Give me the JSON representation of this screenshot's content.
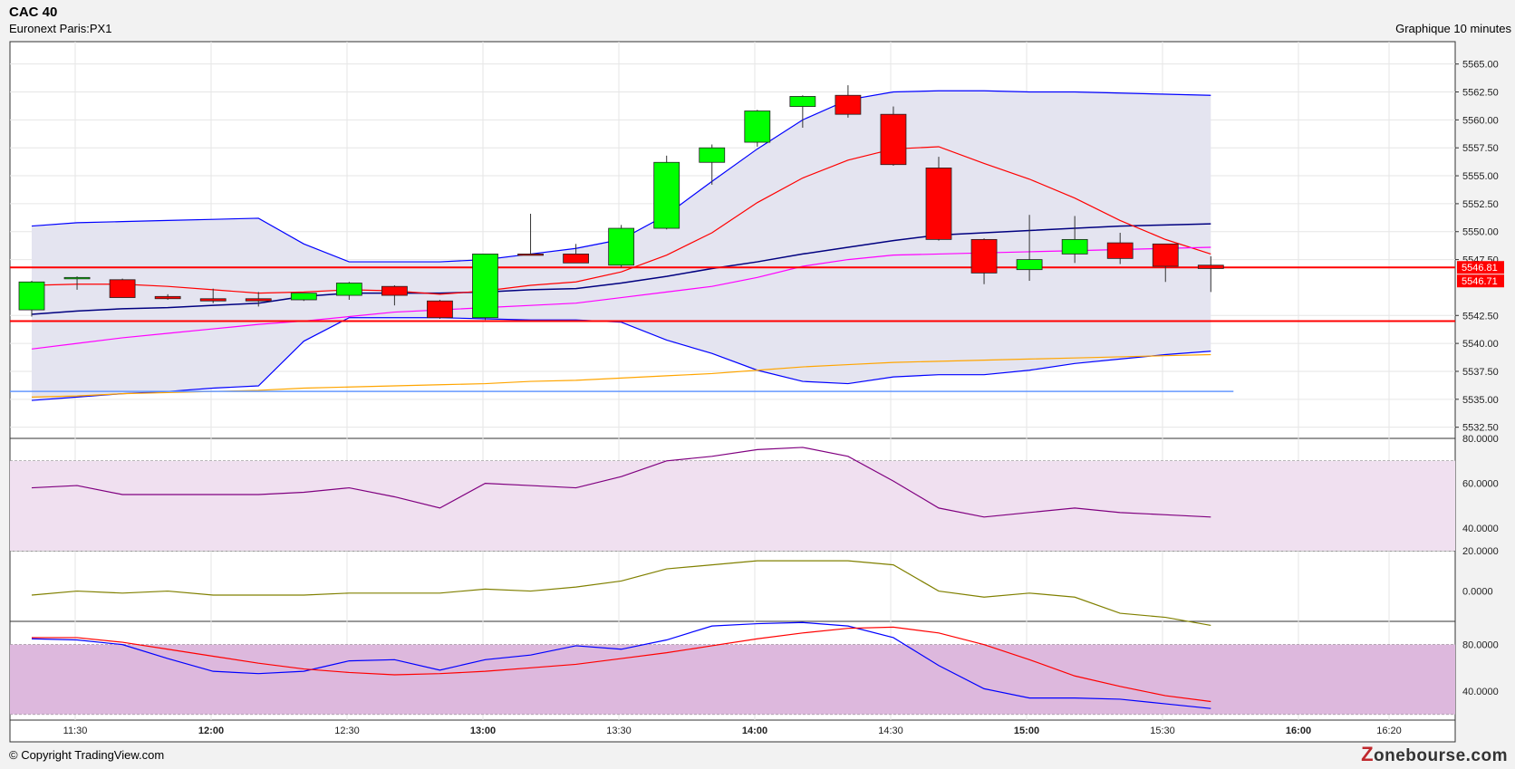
{
  "header": {
    "title": "CAC 40",
    "subtitle": "Euronext Paris:PX1",
    "interval_label": "Graphique 10 minutes"
  },
  "footer": {
    "copyright": "© Copyright TradingView.com",
    "logo_text": "zonebourse.com"
  },
  "colors": {
    "up_candle": "#00ff00",
    "down_candle": "#ff0000",
    "band_fill": "#e4e4f0",
    "band_line": "#0000ff",
    "ma_red": "#ff0000",
    "ma_magenta": "#ff00ff",
    "ma_orange": "#ffa500",
    "ma_light_blue": "#6699ff",
    "hline": "#ff0000",
    "rsi_line": "#800080",
    "rsi_zone": "#f0e0f0",
    "osc_line": "#808000",
    "stoch_fast": "#0000ff",
    "stoch_slow": "#ff0000",
    "stoch_zone": "#ddb8dd"
  },
  "chart_data": {
    "type": "candlestick",
    "x_ticks": [
      "11:30",
      "12:00",
      "12:30",
      "13:00",
      "13:30",
      "14:00",
      "14:30",
      "15:00",
      "15:30",
      "16:00",
      "16:20"
    ],
    "y_ticks": [
      "5565.00",
      "5562.50",
      "5560.00",
      "5557.50",
      "5555.00",
      "5552.50",
      "5550.00",
      "5547.50",
      "5542.50",
      "5540.00",
      "5537.50",
      "5535.00",
      "5532.50"
    ],
    "ylim": [
      5531.5,
      5567
    ],
    "price_labels": [
      "5546.81",
      "5546.71"
    ],
    "horizontal_lines": [
      5546.8,
      5542.0
    ],
    "candles": [
      {
        "time": "11:20",
        "o": 5543.0,
        "h": 5545.6,
        "l": 5542.4,
        "c": 5545.5
      },
      {
        "time": "11:30",
        "o": 5545.8,
        "h": 5546.0,
        "l": 5544.8,
        "c": 5545.9
      },
      {
        "time": "11:40",
        "o": 5545.7,
        "h": 5545.8,
        "l": 5544.1,
        "c": 5544.1
      },
      {
        "time": "11:50",
        "o": 5544.2,
        "h": 5544.4,
        "l": 5543.9,
        "c": 5544.0
      },
      {
        "time": "12:00",
        "o": 5544.0,
        "h": 5544.9,
        "l": 5543.6,
        "c": 5543.8
      },
      {
        "time": "12:10",
        "o": 5544.0,
        "h": 5544.6,
        "l": 5543.3,
        "c": 5543.8
      },
      {
        "time": "12:20",
        "o": 5543.9,
        "h": 5544.5,
        "l": 5543.8,
        "c": 5544.5
      },
      {
        "time": "12:30",
        "o": 5544.3,
        "h": 5545.5,
        "l": 5543.9,
        "c": 5545.4
      },
      {
        "time": "12:40",
        "o": 5545.1,
        "h": 5545.2,
        "l": 5543.4,
        "c": 5544.3
      },
      {
        "time": "12:50",
        "o": 5543.8,
        "h": 5543.9,
        "l": 5542.2,
        "c": 5542.3
      },
      {
        "time": "13:00",
        "o": 5542.3,
        "h": 5548.0,
        "l": 5542.1,
        "c": 5548.0
      },
      {
        "time": "13:10",
        "o": 5548.0,
        "h": 5551.6,
        "l": 5547.9,
        "c": 5547.9
      },
      {
        "time": "13:20",
        "o": 5548.0,
        "h": 5548.9,
        "l": 5547.2,
        "c": 5547.2
      },
      {
        "time": "13:30",
        "o": 5547.0,
        "h": 5550.6,
        "l": 5546.8,
        "c": 5550.3
      },
      {
        "time": "13:40",
        "o": 5550.3,
        "h": 5556.8,
        "l": 5550.2,
        "c": 5556.2
      },
      {
        "time": "13:50",
        "o": 5556.2,
        "h": 5557.8,
        "l": 5554.2,
        "c": 5557.5
      },
      {
        "time": "14:00",
        "o": 5558.0,
        "h": 5560.9,
        "l": 5557.6,
        "c": 5560.8
      },
      {
        "time": "14:10",
        "o": 5561.2,
        "h": 5562.2,
        "l": 5559.3,
        "c": 5562.1
      },
      {
        "time": "14:20",
        "o": 5562.2,
        "h": 5563.1,
        "l": 5560.2,
        "c": 5560.5
      },
      {
        "time": "14:30",
        "o": 5560.5,
        "h": 5561.2,
        "l": 5555.9,
        "c": 5556.0
      },
      {
        "time": "14:40",
        "o": 5555.7,
        "h": 5556.7,
        "l": 5549.2,
        "c": 5549.3
      },
      {
        "time": "14:50",
        "o": 5549.3,
        "h": 5549.4,
        "l": 5545.3,
        "c": 5546.3
      },
      {
        "time": "15:00",
        "o": 5546.6,
        "h": 5551.5,
        "l": 5545.6,
        "c": 5547.5
      },
      {
        "time": "15:10",
        "o": 5548.0,
        "h": 5551.4,
        "l": 5547.2,
        "c": 5549.3
      },
      {
        "time": "15:20",
        "o": 5549.0,
        "h": 5549.9,
        "l": 5547.1,
        "c": 5547.6
      },
      {
        "time": "15:30",
        "o": 5548.9,
        "h": 5548.9,
        "l": 5545.5,
        "c": 5546.9
      },
      {
        "time": "15:40",
        "o": 5547.0,
        "h": 5547.8,
        "l": 5544.6,
        "c": 5546.7
      }
    ],
    "bollinger_upper": [
      5550.5,
      5550.8,
      5550.9,
      5551.0,
      5551.1,
      5551.2,
      5548.9,
      5547.3,
      5547.3,
      5547.3,
      5547.5,
      5548.0,
      5548.5,
      5549.3,
      5551.5,
      5554.5,
      5557.4,
      5560.0,
      5561.8,
      5562.5,
      5562.6,
      5562.6,
      5562.5,
      5562.5,
      5562.4,
      5562.3,
      5562.2
    ],
    "bollinger_lower": [
      5534.9,
      5535.2,
      5535.5,
      5535.7,
      5536.0,
      5536.2,
      5540.2,
      5542.3,
      5542.3,
      5542.3,
      5542.2,
      5542.1,
      5542.1,
      5541.9,
      5540.3,
      5539.1,
      5537.6,
      5536.6,
      5536.4,
      5537.0,
      5537.2,
      5537.2,
      5537.6,
      5538.2,
      5538.6,
      5539.0,
      5539.3
    ],
    "ma_blue": [
      5542.6,
      5542.9,
      5543.1,
      5543.2,
      5543.4,
      5543.6,
      5544.2,
      5544.5,
      5544.5,
      5544.5,
      5544.6,
      5544.8,
      5544.9,
      5545.4,
      5546.0,
      5546.7,
      5547.3,
      5548.0,
      5548.6,
      5549.2,
      5549.7,
      5549.9,
      5550.1,
      5550.3,
      5550.5,
      5550.6,
      5550.7
    ],
    "ma_red": [
      5545.2,
      5545.3,
      5545.3,
      5545.1,
      5544.8,
      5544.5,
      5544.6,
      5544.8,
      5544.7,
      5544.4,
      5544.7,
      5545.2,
      5545.5,
      5546.4,
      5547.9,
      5549.9,
      5552.6,
      5554.8,
      5556.4,
      5557.4,
      5557.6,
      5556.1,
      5554.7,
      5553.0,
      5551.0,
      5549.3,
      5548.0
    ],
    "ma_magenta": [
      5539.5,
      5540.0,
      5540.5,
      5540.9,
      5541.3,
      5541.7,
      5542.0,
      5542.4,
      5542.8,
      5543.0,
      5543.2,
      5543.4,
      5543.6,
      5544.1,
      5544.6,
      5545.1,
      5545.9,
      5546.9,
      5547.5,
      5547.9,
      5548.0,
      5548.1,
      5548.2,
      5548.3,
      5548.4,
      5548.5,
      5548.6
    ],
    "ma_orange": [
      5535.2,
      5535.3,
      5535.5,
      5535.6,
      5535.7,
      5535.8,
      5536.0,
      5536.1,
      5536.2,
      5536.3,
      5536.4,
      5536.6,
      5536.7,
      5536.9,
      5537.1,
      5537.3,
      5537.6,
      5537.9,
      5538.1,
      5538.3,
      5538.4,
      5538.5,
      5538.6,
      5538.7,
      5538.8,
      5538.9,
      5539.0
    ],
    "ma_light_blue_level": 5535.7,
    "rsi": {
      "y_ticks": [
        "80.0000",
        "60.0000",
        "40.0000"
      ],
      "ylim": [
        30,
        80
      ],
      "zone": [
        30,
        70
      ],
      "values": [
        58,
        59,
        55,
        55,
        55,
        55,
        56,
        58,
        54,
        49,
        60,
        59,
        58,
        63,
        70,
        72,
        75,
        76,
        72,
        61,
        49,
        45,
        47,
        49,
        47,
        46,
        45
      ]
    },
    "oscillator": {
      "y_ticks": [
        "20.0000",
        "0.0000"
      ],
      "ylim": [
        -15,
        20
      ],
      "values": [
        -2,
        0,
        -1,
        0,
        -2,
        -2,
        -2,
        -1,
        -1,
        -1,
        1,
        0,
        2,
        5,
        11,
        13,
        15,
        15,
        15,
        13,
        0,
        -3,
        -1,
        -3,
        -11,
        -13,
        -17
      ]
    },
    "stochastic": {
      "y_ticks": [
        "80.0000",
        "40.0000"
      ],
      "ylim": [
        15,
        100
      ],
      "zone": [
        20,
        80
      ],
      "fast": [
        85,
        84,
        80,
        68,
        57,
        55,
        57,
        66,
        67,
        58,
        67,
        71,
        79,
        76,
        84,
        96,
        98,
        99,
        96,
        86,
        62,
        42,
        34,
        34,
        33,
        29,
        25
      ],
      "slow": [
        86,
        86,
        82,
        76,
        70,
        64,
        59,
        56,
        54,
        55,
        57,
        60,
        63,
        68,
        73,
        79,
        85,
        90,
        94,
        95,
        90,
        80,
        67,
        53,
        44,
        36,
        31
      ]
    }
  }
}
